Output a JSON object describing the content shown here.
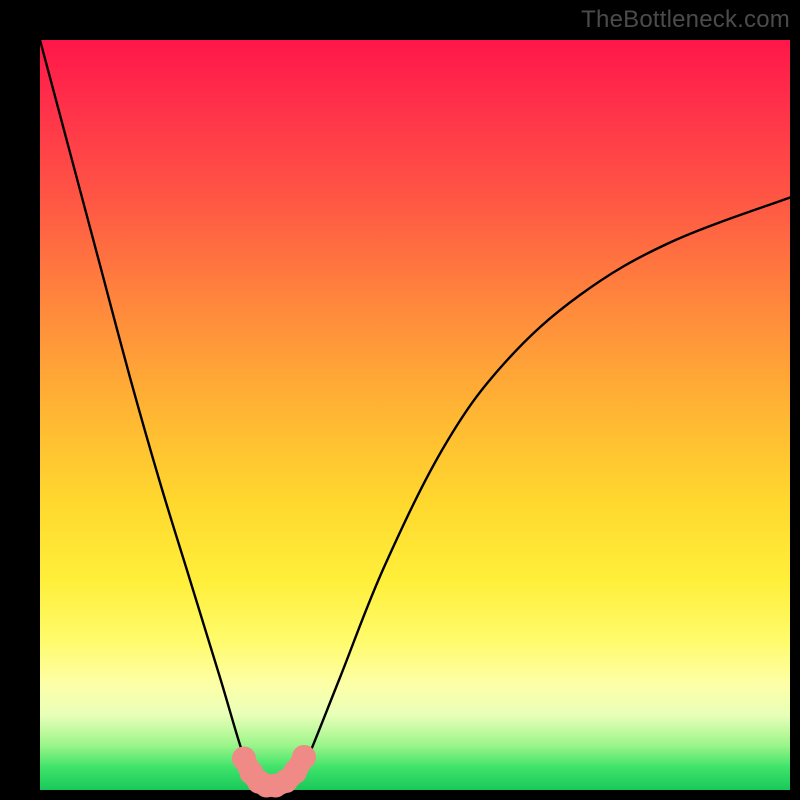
{
  "watermark": "TheBottleneck.com",
  "chart_data": {
    "type": "line",
    "title": "",
    "xlabel": "",
    "ylabel": "",
    "xlim": [
      0,
      100
    ],
    "ylim": [
      0,
      100
    ],
    "grid": false,
    "legend": false,
    "series": [
      {
        "name": "bottleneck-curve",
        "color": "#000000",
        "x": [
          0,
          4,
          8,
          12,
          16,
          20,
          24,
          27,
          28.5,
          30,
          31.5,
          33,
          34.5,
          36,
          40,
          46,
          54,
          62,
          72,
          84,
          100
        ],
        "y": [
          100,
          85,
          70,
          55,
          41,
          28,
          15,
          5,
          2,
          0.5,
          0,
          0.5,
          2,
          5,
          15,
          30,
          46,
          57,
          66,
          73,
          79
        ]
      }
    ],
    "markers": {
      "name": "trough-marker",
      "color": "#ef8a86",
      "stroke_width": 12,
      "x": [
        27.2,
        28.2,
        29.2,
        30.2,
        31.4,
        32.8,
        34.0,
        35.2
      ],
      "y": [
        4.2,
        2.3,
        1.1,
        0.6,
        0.6,
        1.2,
        2.4,
        4.4
      ]
    }
  }
}
